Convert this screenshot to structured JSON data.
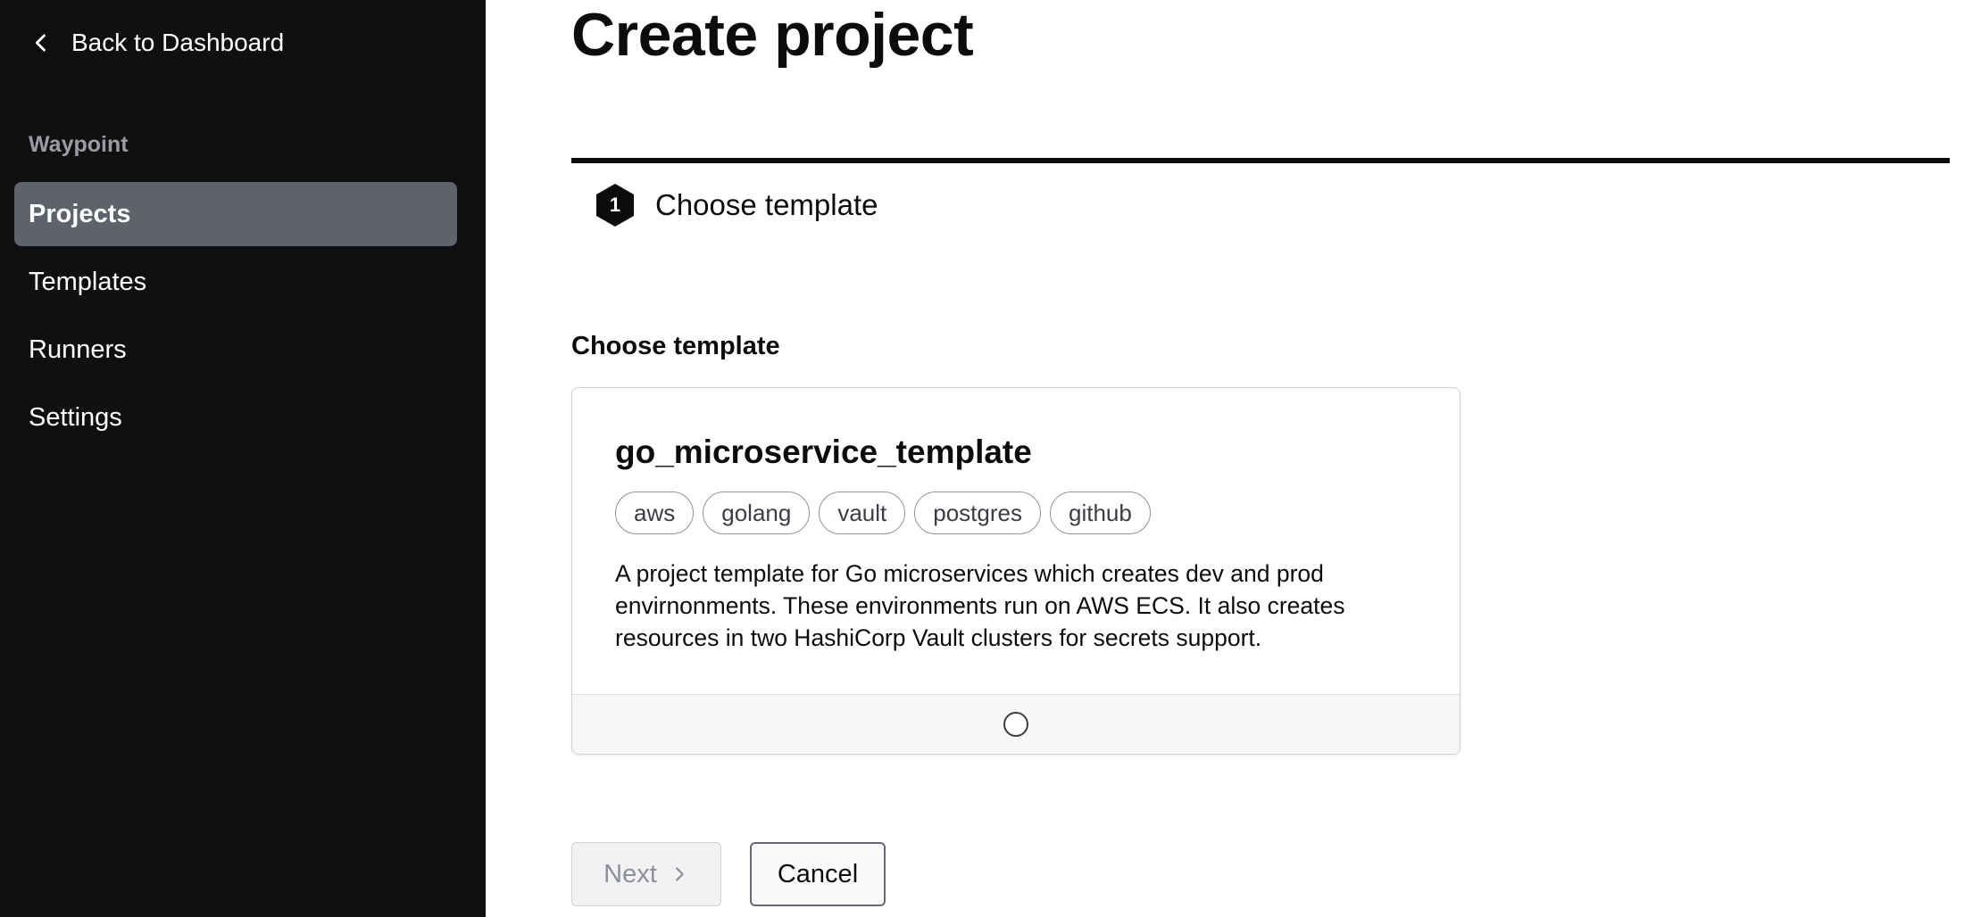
{
  "sidebar": {
    "back_label": "Back to Dashboard",
    "section_label": "Waypoint",
    "items": [
      {
        "label": "Projects",
        "active": true
      },
      {
        "label": "Templates",
        "active": false
      },
      {
        "label": "Runners",
        "active": false
      },
      {
        "label": "Settings",
        "active": false
      }
    ]
  },
  "main": {
    "title": "Create project",
    "stepper": {
      "step_number": "1",
      "step_label": "Choose template"
    },
    "section_heading": "Choose template",
    "template_card": {
      "title": "go_microservice_template",
      "tags": [
        "aws",
        "golang",
        "vault",
        "postgres",
        "github"
      ],
      "description": "A project template for Go microservices which creates dev and prod envirnonments. These environments run on AWS ECS. It also creates resources in two HashiCorp Vault clusters for secrets support.",
      "selected": false
    },
    "buttons": {
      "next_label": "Next",
      "next_disabled": true,
      "cancel_label": "Cancel"
    }
  },
  "icons": {
    "back": "chevron-left-icon",
    "next": "chevron-right-icon",
    "step": "hexagon-step-icon"
  },
  "colors": {
    "sidebar_bg": "#101010",
    "active_nav": "#5e626c",
    "text": "#0c0c0e"
  }
}
